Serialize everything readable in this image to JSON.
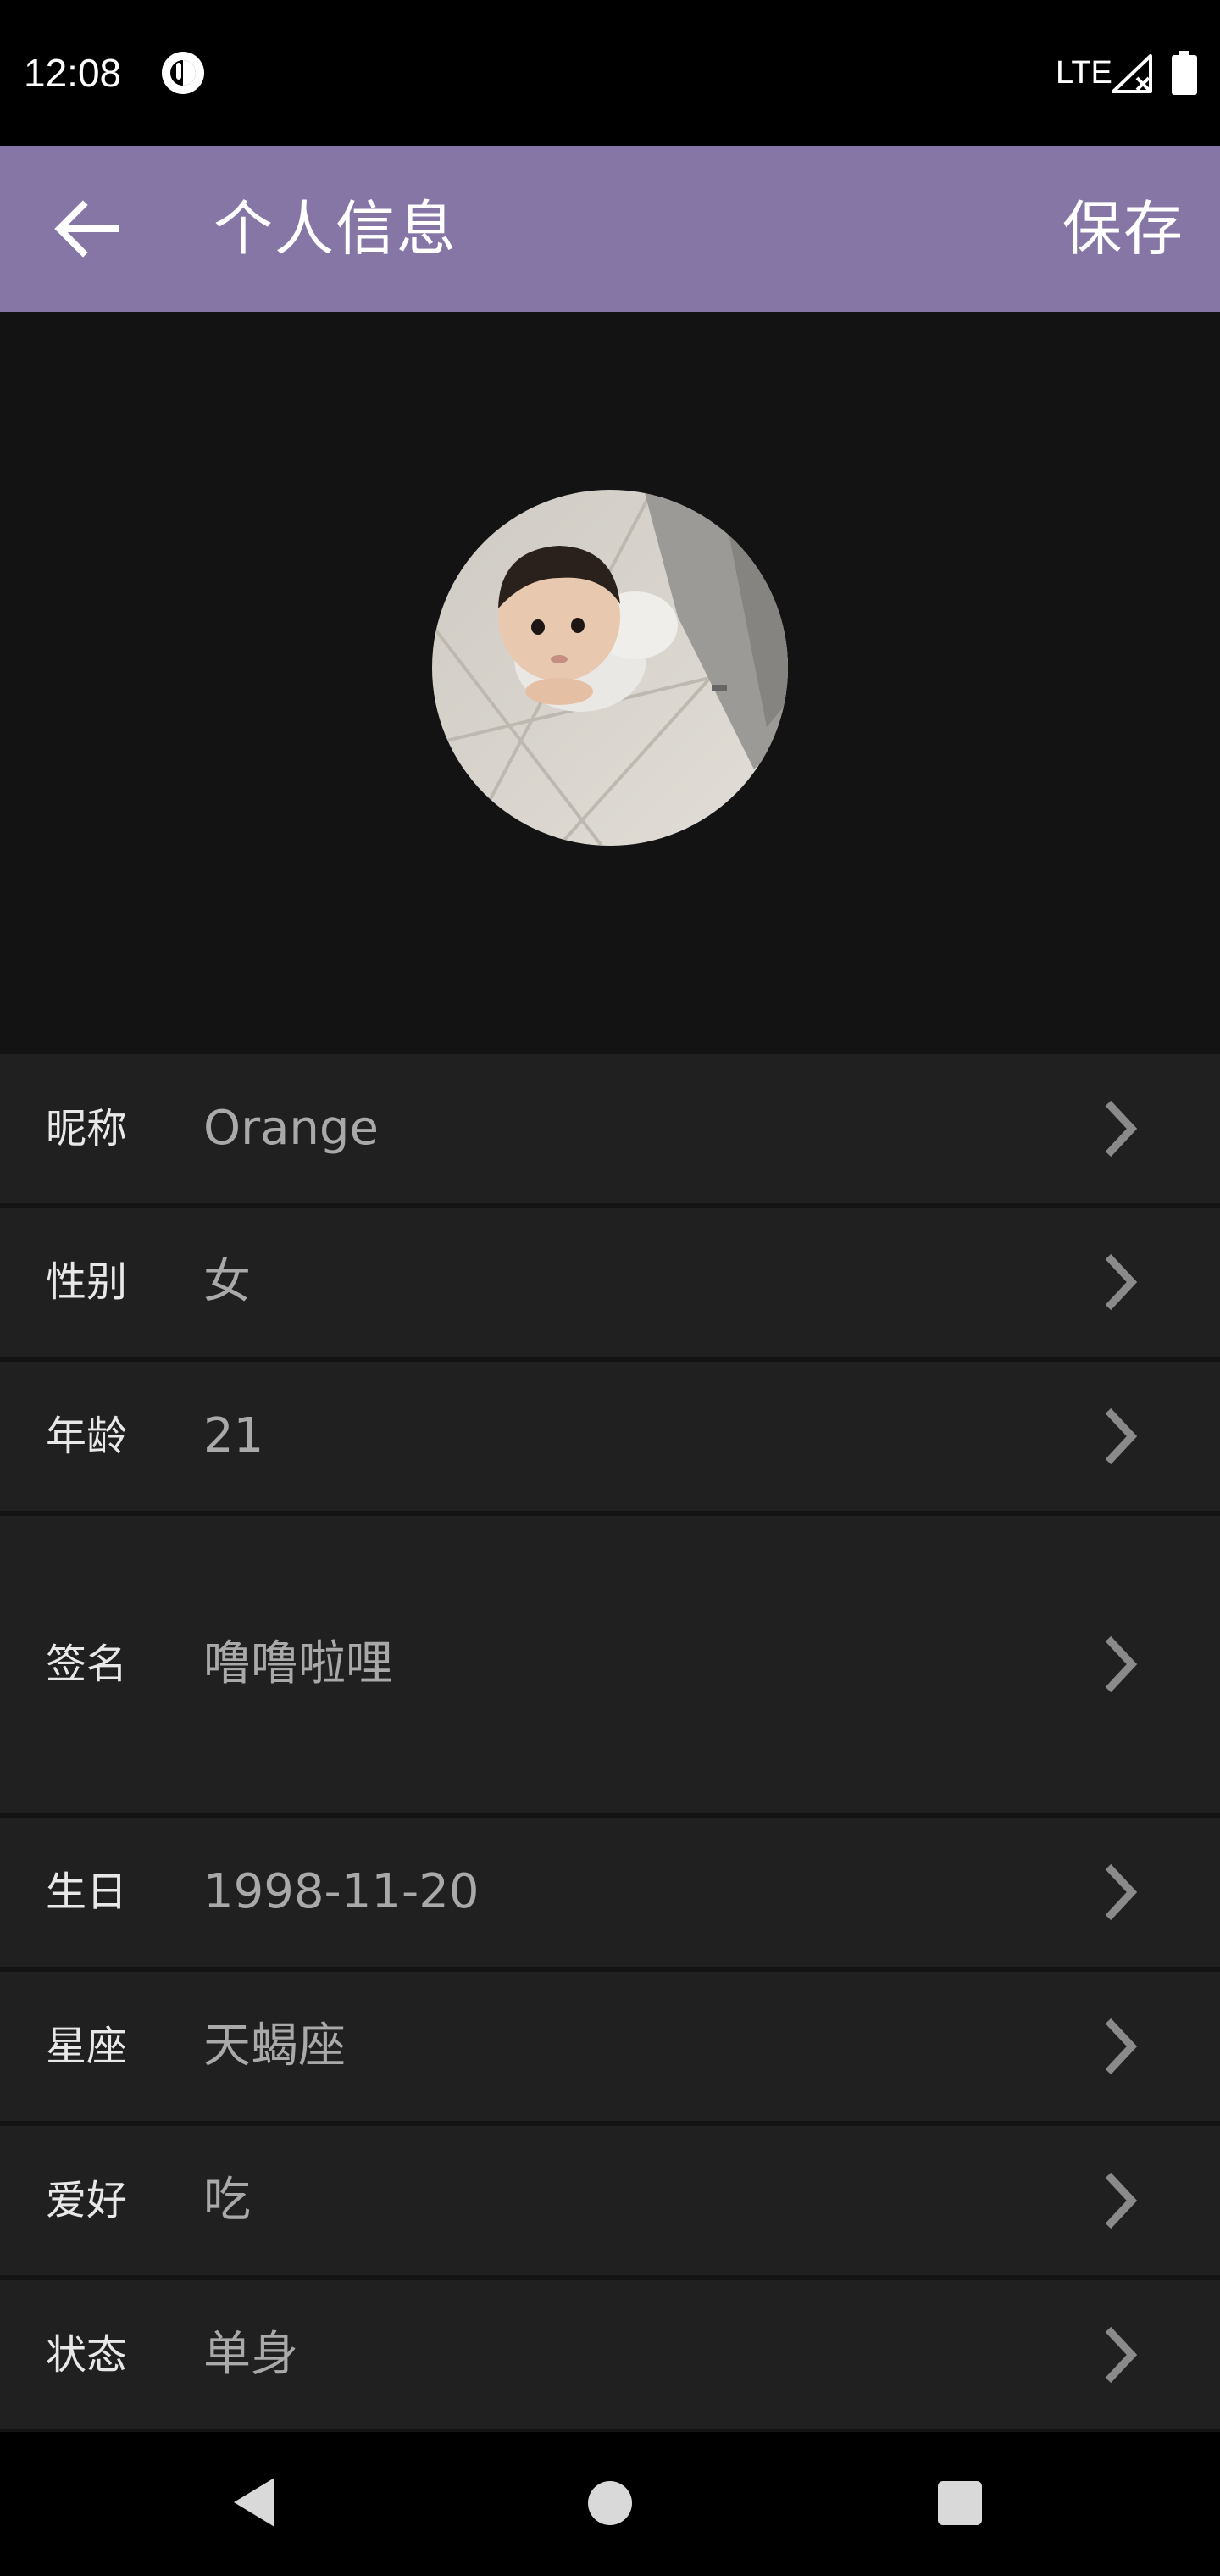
{
  "status_bar": {
    "time": "12:08",
    "network": "LTE"
  },
  "app_bar": {
    "title": "个人信息",
    "save_label": "保存"
  },
  "profile_rows": [
    {
      "label": "昵称",
      "value": "Orange"
    },
    {
      "label": "性别",
      "value": "女"
    },
    {
      "label": "年龄",
      "value": "21"
    },
    {
      "label": "签名",
      "value": "噜噜啦哩"
    },
    {
      "label": "生日",
      "value": "1998-11-20"
    },
    {
      "label": "星座",
      "value": "天蝎座"
    },
    {
      "label": "爱好",
      "value": "吃"
    },
    {
      "label": "状态",
      "value": "单身"
    }
  ],
  "colors": {
    "app_bar": "#8676a5",
    "background": "#131313",
    "row_background": "#202020",
    "value_text": "#a9a9a9"
  }
}
